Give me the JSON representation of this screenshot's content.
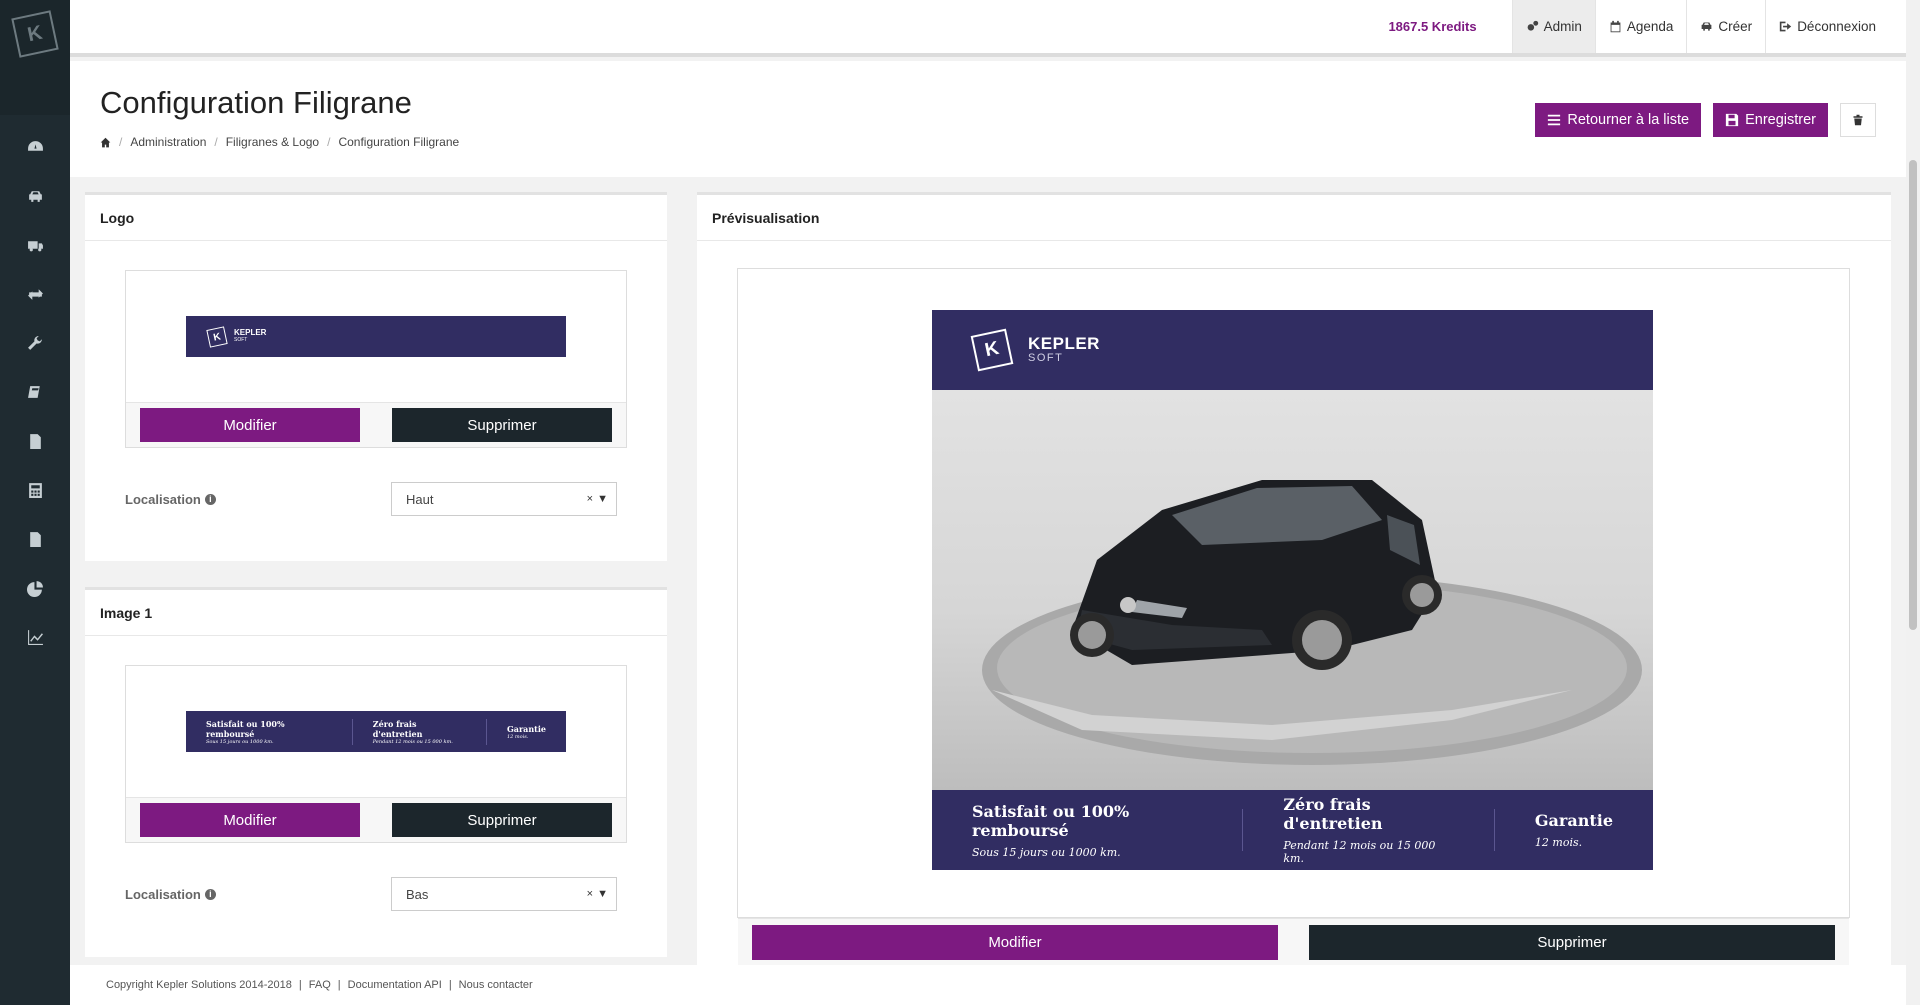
{
  "topbar": {
    "credits": "1867.5 Kredits",
    "items": [
      {
        "label": "Admin",
        "icon": "gears-icon"
      },
      {
        "label": "Agenda",
        "icon": "calendar-icon"
      },
      {
        "label": "Créer",
        "icon": "car-icon"
      },
      {
        "label": "Déconnexion",
        "icon": "sign-out-icon"
      }
    ]
  },
  "sidebar": {
    "logo_letter": "K",
    "items": [
      "dashboard-icon",
      "car-icon",
      "truck-icon",
      "exchange-icon",
      "wrench-icon",
      "book-icon",
      "file-icon",
      "calculator-icon",
      "file-text-icon",
      "pie-chart-icon",
      "line-chart-icon"
    ]
  },
  "header": {
    "title": "Configuration Filigrane",
    "breadcrumb": [
      "Administration",
      "Filigranes & Logo",
      "Configuration Filigrane"
    ],
    "btn_back": "Retourner à la liste",
    "btn_save": "Enregistrer"
  },
  "logo_panel": {
    "title": "Logo",
    "modify": "Modifier",
    "delete": "Supprimer",
    "location_label": "Localisation",
    "location_value": "Haut",
    "select_clear": "×"
  },
  "image1_panel": {
    "title": "Image 1",
    "modify": "Modifier",
    "delete": "Supprimer",
    "location_label": "Localisation",
    "location_value": "Bas",
    "select_clear": "×"
  },
  "preview_panel": {
    "title": "Prévisualisation",
    "modify": "Modifier",
    "delete": "Supprimer"
  },
  "watermark": {
    "brand": "KEPLER",
    "brand_sub": "SOFT",
    "features": [
      {
        "title": "Satisfait ou 100% remboursé",
        "sub": "Sous 15 jours ou 1000 km."
      },
      {
        "title": "Zéro frais d'entretien",
        "sub": "Pendant 12 mois ou 15 000 km."
      },
      {
        "title": "Garantie",
        "sub": "12 mois."
      }
    ]
  },
  "footer": {
    "copyright": "Copyright Kepler Solutions 2014-2018",
    "links": [
      "FAQ",
      "Documentation API",
      "Nous contacter"
    ],
    "separator": "|"
  },
  "colors": {
    "accent": "#7d1a81",
    "dark_button": "#1c262c",
    "banner": "#312d62",
    "sidebar": "#1f2b31"
  }
}
